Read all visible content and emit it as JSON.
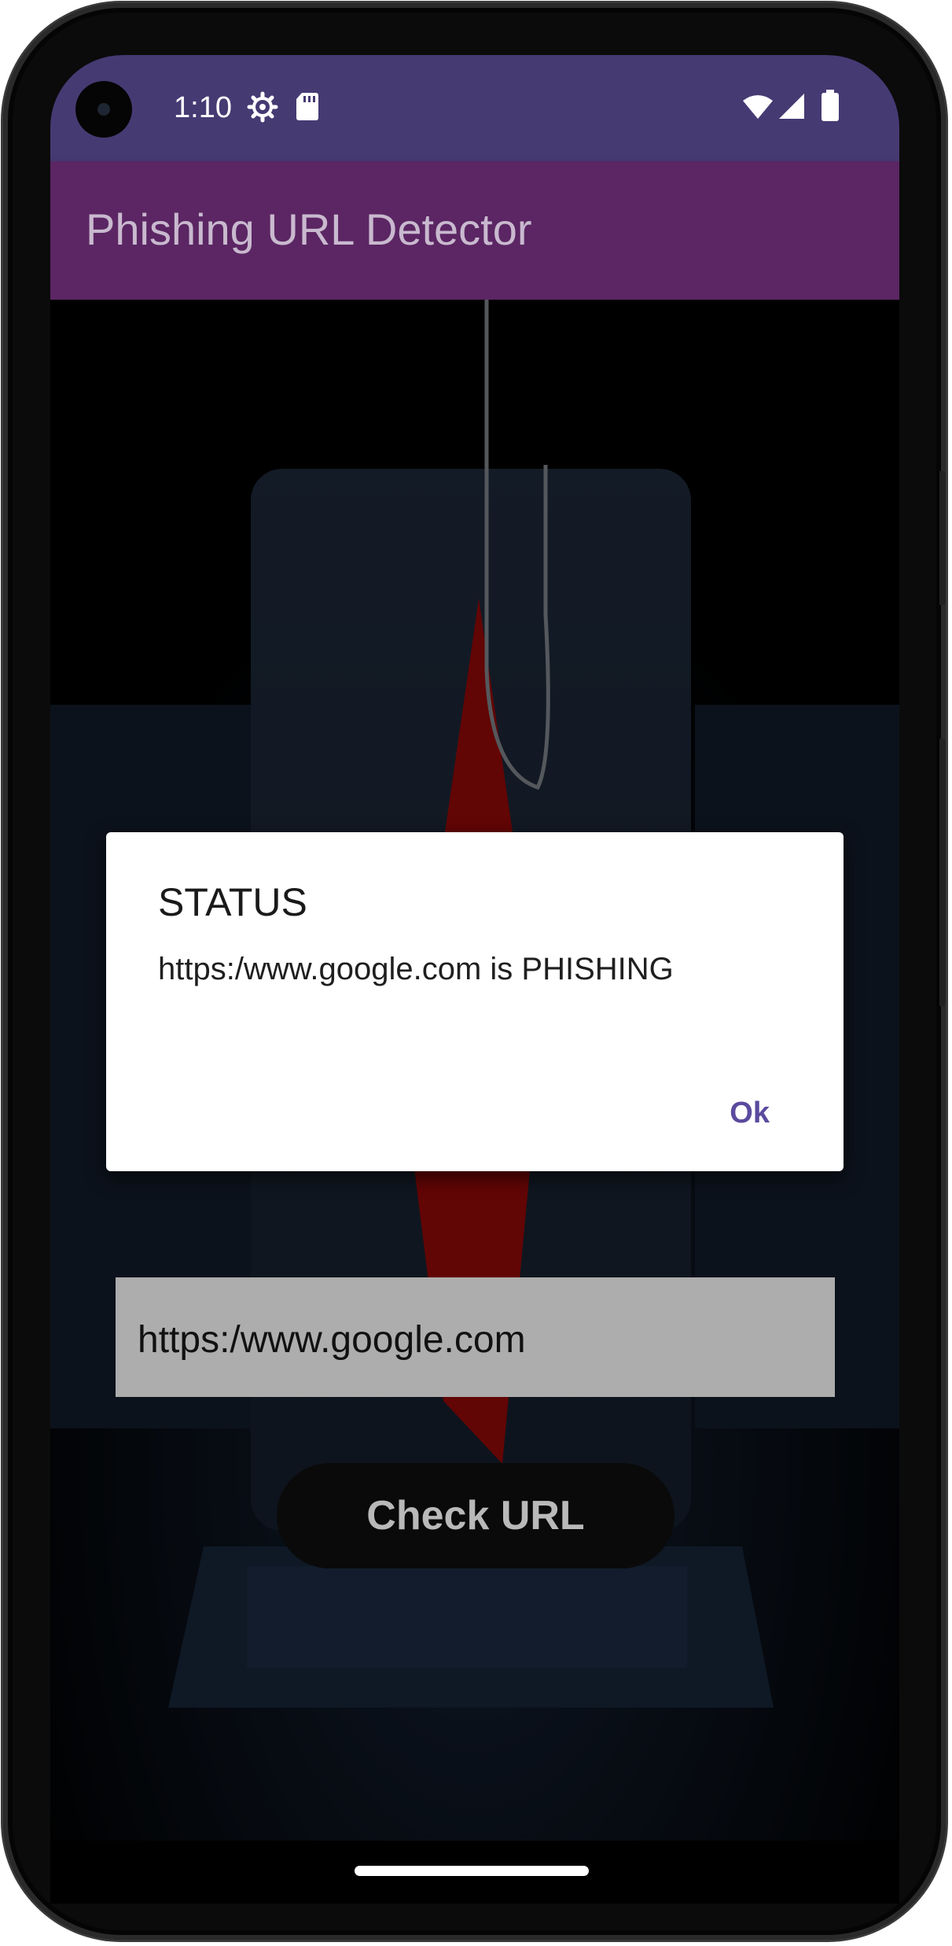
{
  "status_bar": {
    "time": "1:10",
    "icons": [
      "settings-gear-icon",
      "sd-card-icon",
      "wifi-icon",
      "signal-icon",
      "battery-icon"
    ]
  },
  "app_bar": {
    "title": "Phishing URL Detector"
  },
  "main": {
    "url_input_value": "https:/www.google.com",
    "check_button_label": "Check URL"
  },
  "dialog": {
    "title": "STATUS",
    "message": "https:/www.google.com is PHISHING",
    "ok_label": "Ok"
  },
  "colors": {
    "status_bar": "#463a73",
    "app_bar": "#5b2663",
    "dialog_button": "#5b4a9e",
    "hook_accent": "#b30a0a"
  }
}
